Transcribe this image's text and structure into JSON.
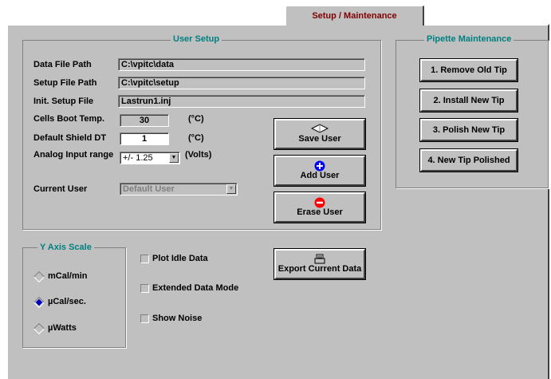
{
  "tab": {
    "label": "Setup / Maintenance"
  },
  "user_setup": {
    "title": "User Setup",
    "data_file_path": {
      "label": "Data File Path",
      "value": "C:\\vpitc\\data"
    },
    "setup_file_path": {
      "label": "Setup File Path",
      "value": "C:\\vpitc\\setup"
    },
    "init_setup_file": {
      "label": "Init. Setup File",
      "value": "Lastrun1.inj"
    },
    "cells_boot_temp": {
      "label": "Cells Boot Temp.",
      "value": "30",
      "unit": "(°C)"
    },
    "default_shield_dt": {
      "label": "Default Shield DT",
      "value": "1",
      "unit": "(°C)"
    },
    "analog_input_range": {
      "label": "Analog Input range",
      "value": "+/- 1.25",
      "unit": "(Volts)"
    },
    "current_user": {
      "label": "Current User",
      "value": "Default User"
    },
    "save_user": "Save User",
    "add_user": "Add User",
    "erase_user": "Erase User"
  },
  "pipette": {
    "title": "Pipette Maintenance",
    "remove_old_tip": "1. Remove Old Tip",
    "install_new_tip": "2. Install New Tip",
    "polish_new_tip": "3. Polish New Tip",
    "new_tip_polished": "4. New Tip Polished"
  },
  "y_axis": {
    "title": "Y Axis Scale",
    "options": [
      "mCal/min",
      "µCal/sec.",
      "µWatts"
    ],
    "selected": "µCal/sec."
  },
  "options": {
    "plot_idle_data": "Plot Idle Data",
    "extended_data_mode": "Extended Data Mode",
    "show_noise": "Show Noise"
  },
  "export": {
    "label": "Export Current Data"
  },
  "colors": {
    "panel": "#c0c0c0",
    "group_title": "#008080",
    "tab_text": "#800000",
    "add_icon": "#0000ff",
    "erase_icon": "#ff0000"
  }
}
